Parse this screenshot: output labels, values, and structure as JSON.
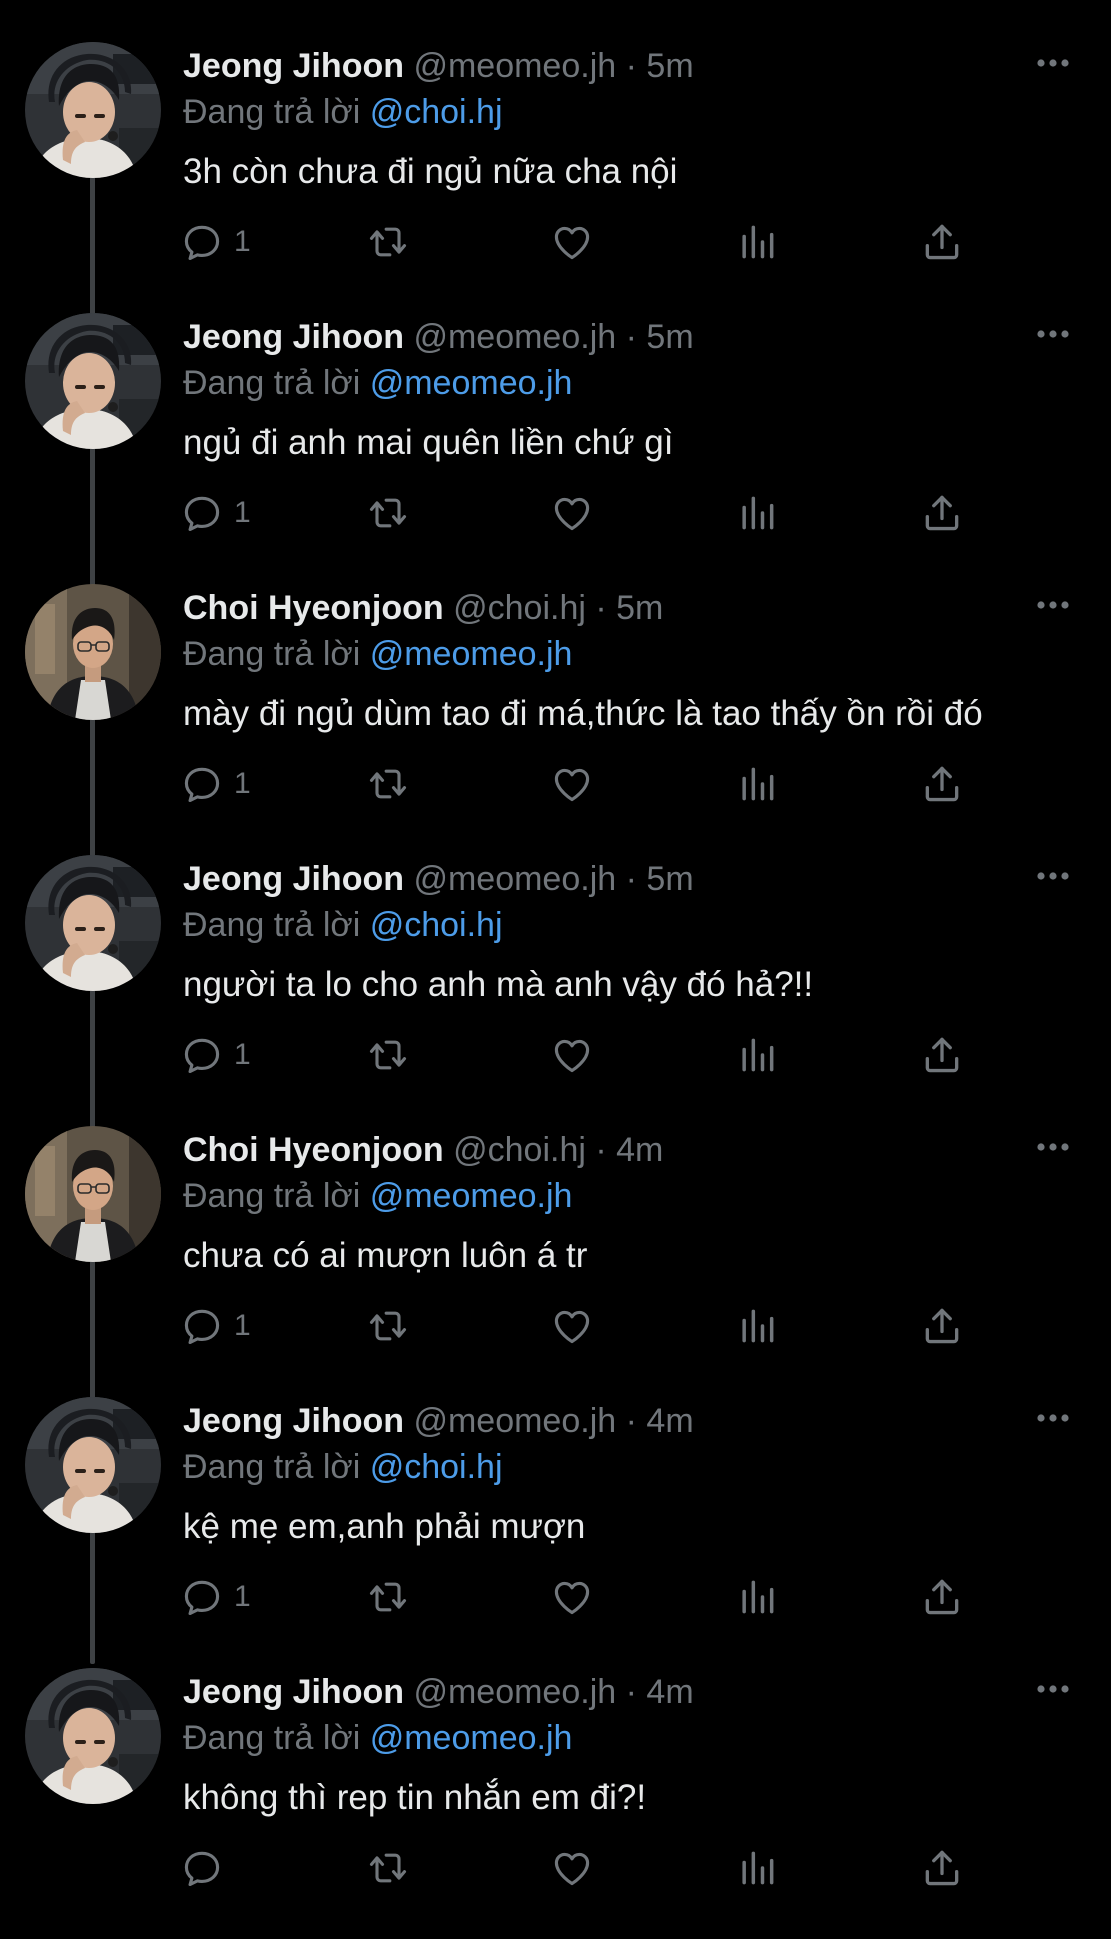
{
  "labels": {
    "replying_to": "Đang trả lời",
    "separator": "·"
  },
  "colors": {
    "background": "#000000",
    "text": "#e7e9ea",
    "muted": "#71767b",
    "mention": "#4d9ce8",
    "thread_line": "#3e4144"
  },
  "icons": {
    "reply": "reply-icon",
    "retweet": "retweet-icon",
    "like": "heart-icon",
    "views": "views-chart-icon",
    "share": "share-icon",
    "more": "more-dots-icon"
  },
  "tweets": [
    {
      "author": "Jeong Jihoon",
      "handle": "@meomeo.jh",
      "time": "5m",
      "reply_to": "@choi.hj",
      "text": "3h còn chưa đi ngủ nữa cha nội",
      "reply_count": "1"
    },
    {
      "author": "Jeong Jihoon",
      "handle": "@meomeo.jh",
      "time": "5m",
      "reply_to": "@meomeo.jh",
      "text": "ngủ đi anh mai quên liền chứ gì",
      "reply_count": "1"
    },
    {
      "author": "Choi Hyeonjoon",
      "handle": "@choi.hj",
      "time": "5m",
      "reply_to": "@meomeo.jh",
      "text": "mày đi ngủ dùm tao đi má,thức là tao thấy ồn rồi đó",
      "reply_count": "1"
    },
    {
      "author": "Jeong Jihoon",
      "handle": "@meomeo.jh",
      "time": "5m",
      "reply_to": "@choi.hj",
      "text": "người ta lo cho anh mà anh vậy đó hả?!!",
      "reply_count": "1"
    },
    {
      "author": "Choi Hyeonjoon",
      "handle": "@choi.hj",
      "time": "4m",
      "reply_to": "@meomeo.jh",
      "text": "chưa có ai mượn luôn á tr",
      "reply_count": "1"
    },
    {
      "author": "Jeong Jihoon",
      "handle": "@meomeo.jh",
      "time": "4m",
      "reply_to": "@choi.hj",
      "text": "kệ mẹ em,anh phải mượn",
      "reply_count": "1"
    },
    {
      "author": "Jeong Jihoon",
      "handle": "@meomeo.jh",
      "time": "4m",
      "reply_to": "@meomeo.jh",
      "text": "không thì rep tin nhắn em đi?!",
      "reply_count": ""
    }
  ]
}
